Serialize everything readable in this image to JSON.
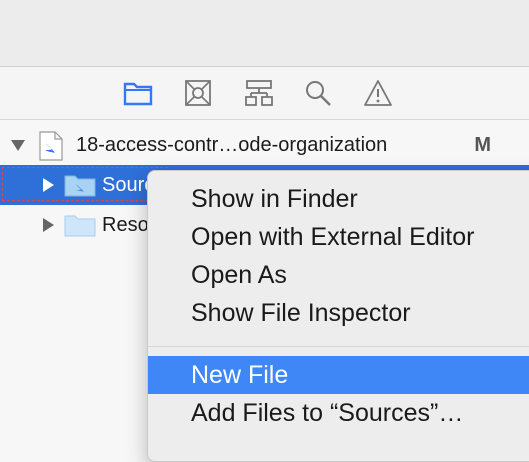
{
  "toolbar": {
    "icons": [
      "folder-icon",
      "source-control-icon",
      "hierarchy-icon",
      "search-icon",
      "warning-icon"
    ],
    "accent": "#3478f6"
  },
  "tree": {
    "project": {
      "label": "18-access-contr…ode-organization",
      "badge": "M"
    },
    "items": [
      {
        "label": "Sources",
        "selected": true
      },
      {
        "label": "Resources",
        "selected": false
      }
    ]
  },
  "context_menu": {
    "items": [
      {
        "label": "Show in Finder"
      },
      {
        "label": "Open with External Editor"
      },
      {
        "label": "Open As"
      },
      {
        "label": "Show File Inspector"
      }
    ],
    "items2": [
      {
        "label": "New File",
        "highlighted": true
      },
      {
        "label": "Add Files to “Sources”…"
      }
    ]
  },
  "colors": {
    "selection": "#2f6fd8",
    "menu_highlight": "#3f86f7"
  }
}
